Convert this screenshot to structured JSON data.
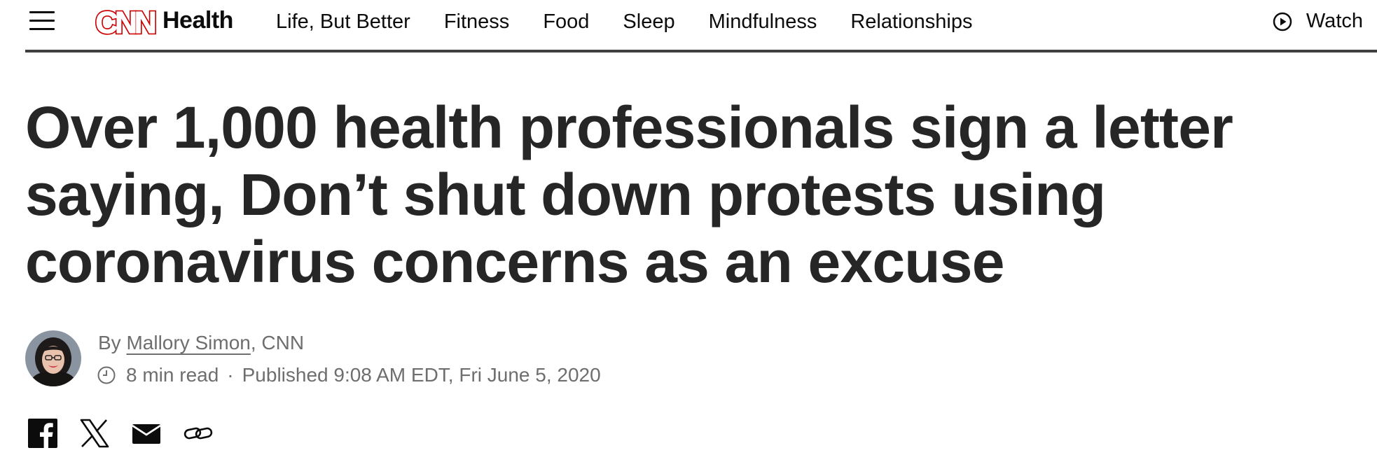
{
  "header": {
    "logo_text": "CNN",
    "section": "Health",
    "nav_items": [
      "Life, But Better",
      "Fitness",
      "Food",
      "Sleep",
      "Mindfulness",
      "Relationships"
    ],
    "watch_label": "Watch",
    "brand_color": "#cc0000"
  },
  "article": {
    "headline": "Over 1,000 health professionals sign a letter saying, Don’t shut down protests using coronavirus concerns as an excuse",
    "byline_prefix": "By ",
    "author": "Mallory Simon",
    "outlet": ", CNN",
    "read_time": "8 min read",
    "separator": "·",
    "published": "Published 9:08 AM EDT, Fri June 5, 2020"
  },
  "share": {
    "icons": [
      "facebook-icon",
      "x-icon",
      "email-icon",
      "link-icon"
    ]
  }
}
